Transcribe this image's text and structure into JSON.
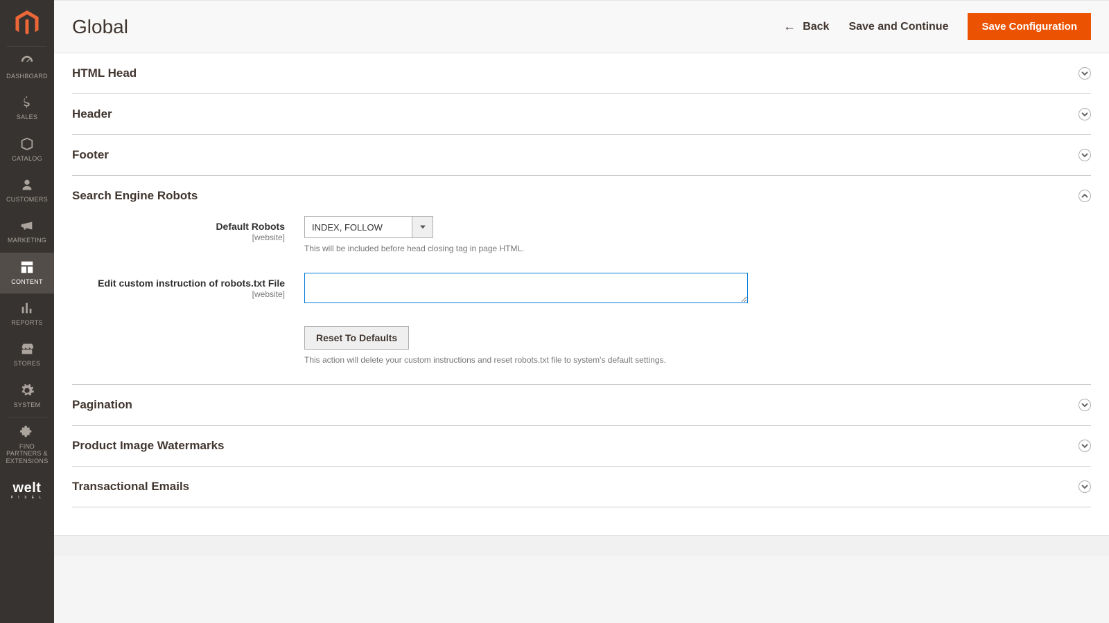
{
  "sidebar": {
    "items": [
      {
        "label": "DASHBOARD"
      },
      {
        "label": "SALES"
      },
      {
        "label": "CATALOG"
      },
      {
        "label": "CUSTOMERS"
      },
      {
        "label": "MARKETING"
      },
      {
        "label": "CONTENT"
      },
      {
        "label": "REPORTS"
      },
      {
        "label": "STORES"
      },
      {
        "label": "SYSTEM"
      },
      {
        "label": "FIND PARTNERS & EXTENSIONS"
      }
    ],
    "welt_brand": "welt",
    "welt_sub": "P I X E L"
  },
  "header": {
    "title": "Global",
    "back_label": "Back",
    "save_continue_label": "Save and Continue",
    "save_config_label": "Save Configuration"
  },
  "sections": {
    "html_head": "HTML Head",
    "header": "Header",
    "footer": "Footer",
    "search_robots": "Search Engine Robots",
    "pagination": "Pagination",
    "watermarks": "Product Image Watermarks",
    "emails": "Transactional Emails"
  },
  "robots": {
    "default_robots_label": "Default Robots",
    "scope": "[website]",
    "default_robots_value": "INDEX, FOLLOW",
    "default_robots_help": "This will be included before head closing tag in page HTML.",
    "custom_instruction_label": "Edit custom instruction of robots.txt File",
    "custom_instruction_value": "",
    "reset_button": "Reset To Defaults",
    "reset_help": "This action will delete your custom instructions and reset robots.txt file to system's default settings."
  }
}
